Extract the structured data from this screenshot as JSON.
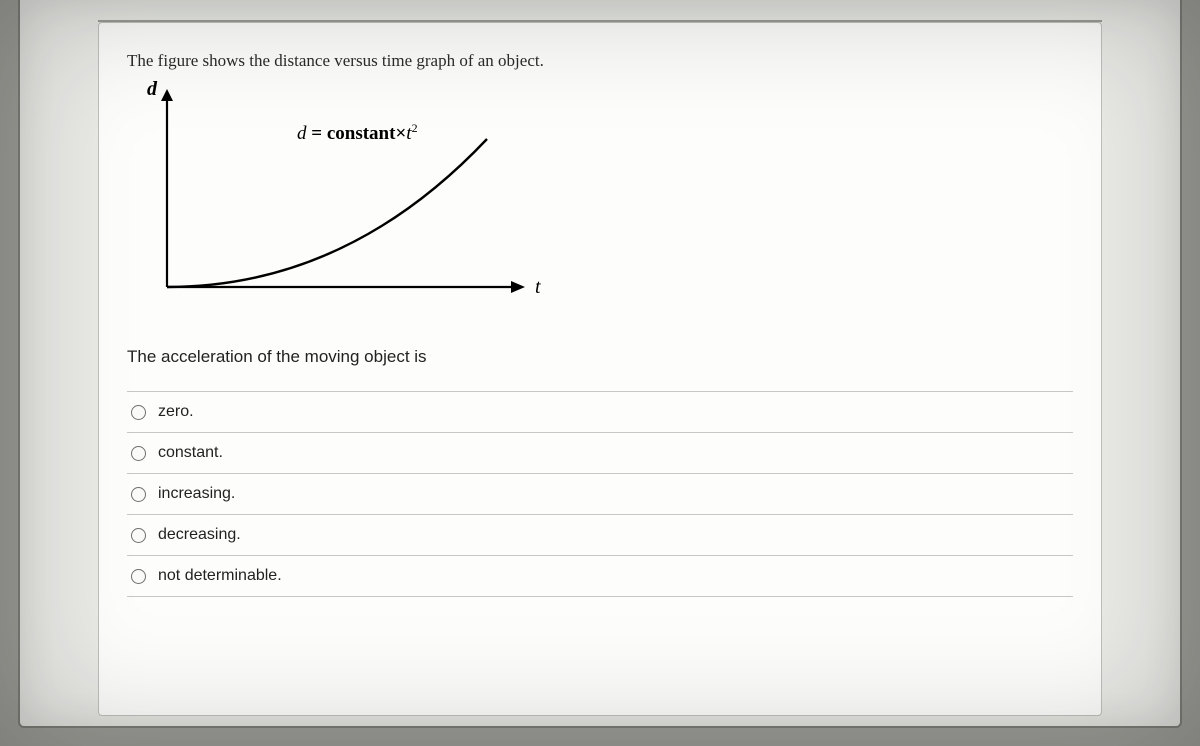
{
  "prompt": "The figure shows the distance versus time graph of an object.",
  "graph": {
    "y_axis_label": "d",
    "x_axis_label": "t",
    "curve_equation_prefix": "d",
    "curve_equation_middle": " = constant×",
    "curve_equation_var": "t",
    "curve_equation_exponent": "2"
  },
  "subquestion": "The acceleration of the moving object is",
  "options": [
    {
      "label": "zero."
    },
    {
      "label": "constant."
    },
    {
      "label": "increasing."
    },
    {
      "label": "decreasing."
    },
    {
      "label": "not determinable."
    }
  ],
  "chart_data": {
    "type": "line",
    "title": "",
    "xlabel": "t",
    "ylabel": "d",
    "annotations": [
      "d = constant × t²"
    ],
    "x": [
      0,
      0.2,
      0.4,
      0.6,
      0.8,
      1.0
    ],
    "y": [
      0,
      0.04,
      0.16,
      0.36,
      0.64,
      1.0
    ],
    "xlim": [
      0,
      1
    ],
    "ylim": [
      0,
      1
    ]
  }
}
